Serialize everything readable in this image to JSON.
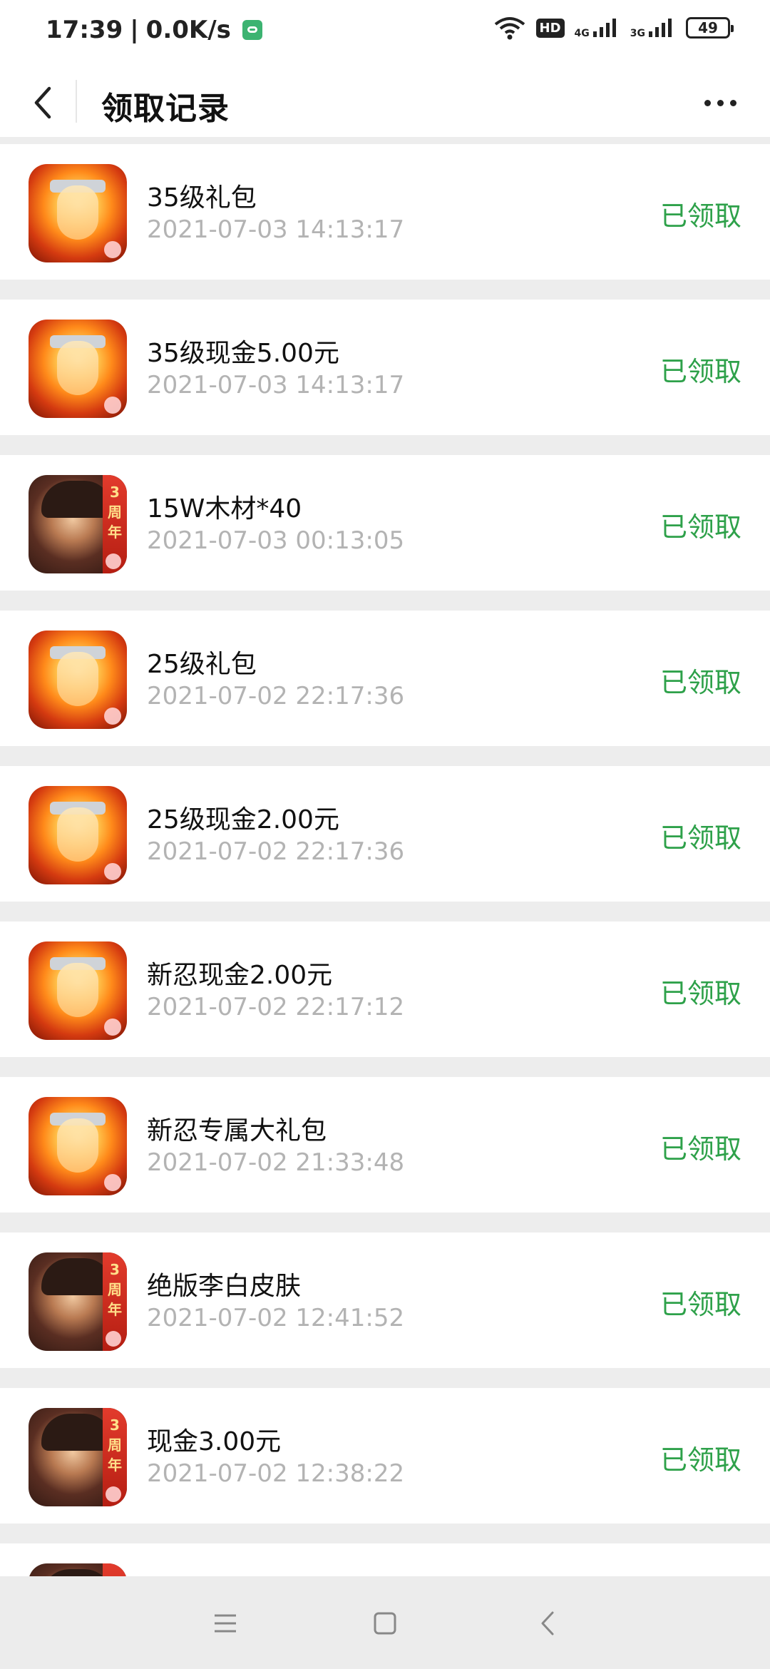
{
  "status_bar": {
    "time": "17:39",
    "speed": "0.0K/s",
    "hd_badge": "HD",
    "net_4g": "4G",
    "net_3g": "3G",
    "battery": "49"
  },
  "header": {
    "title": "领取记录"
  },
  "records": [
    {
      "game": "naruto",
      "title": "35级礼包",
      "time": "2021-07-03 14:13:17",
      "status": "已领取"
    },
    {
      "game": "naruto",
      "title": "35级现金5.00元",
      "time": "2021-07-03 14:13:17",
      "status": "已领取"
    },
    {
      "game": "libai",
      "title": "15W木材*40",
      "time": "2021-07-03 00:13:05",
      "status": "已领取"
    },
    {
      "game": "naruto",
      "title": "25级礼包",
      "time": "2021-07-02 22:17:36",
      "status": "已领取"
    },
    {
      "game": "naruto",
      "title": "25级现金2.00元",
      "time": "2021-07-02 22:17:36",
      "status": "已领取"
    },
    {
      "game": "naruto",
      "title": "新忍现金2.00元",
      "time": "2021-07-02 22:17:12",
      "status": "已领取"
    },
    {
      "game": "naruto",
      "title": "新忍专属大礼包",
      "time": "2021-07-02 21:33:48",
      "status": "已领取"
    },
    {
      "game": "libai",
      "title": "绝版李白皮肤",
      "time": "2021-07-02 12:41:52",
      "status": "已领取"
    },
    {
      "game": "libai",
      "title": "现金3.00元",
      "time": "2021-07-02 12:38:22",
      "status": "已领取"
    }
  ],
  "icon_badge_text": "3周年",
  "colors": {
    "status_green": "#2ea14a",
    "time_gray": "#b3b3b3",
    "background": "#ededed"
  }
}
